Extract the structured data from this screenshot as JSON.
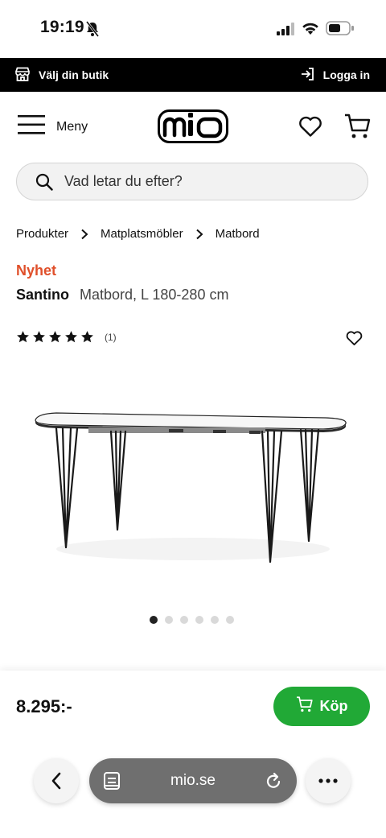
{
  "status": {
    "time": "19:19"
  },
  "topbar": {
    "store_label": "Välj din butik",
    "login_label": "Logga in"
  },
  "header": {
    "menu_label": "Meny",
    "logo_text": "mio"
  },
  "search": {
    "placeholder": "Vad letar du efter?"
  },
  "breadcrumb": [
    "Produkter",
    "Matplatsmöbler",
    "Matbord"
  ],
  "product": {
    "badge": "Nyhet",
    "brand": "Santino",
    "description": "Matbord, L 180-280 cm",
    "rating_stars": 5,
    "rating_count": "(1)",
    "image_index": 1,
    "image_count": 6
  },
  "buy": {
    "price": "8.295:-",
    "button_label": "Köp",
    "button_color": "#21a936"
  },
  "browser": {
    "url": "mio.se"
  },
  "colors": {
    "accent_new": "#e0502b",
    "topbar_bg": "#000000"
  }
}
